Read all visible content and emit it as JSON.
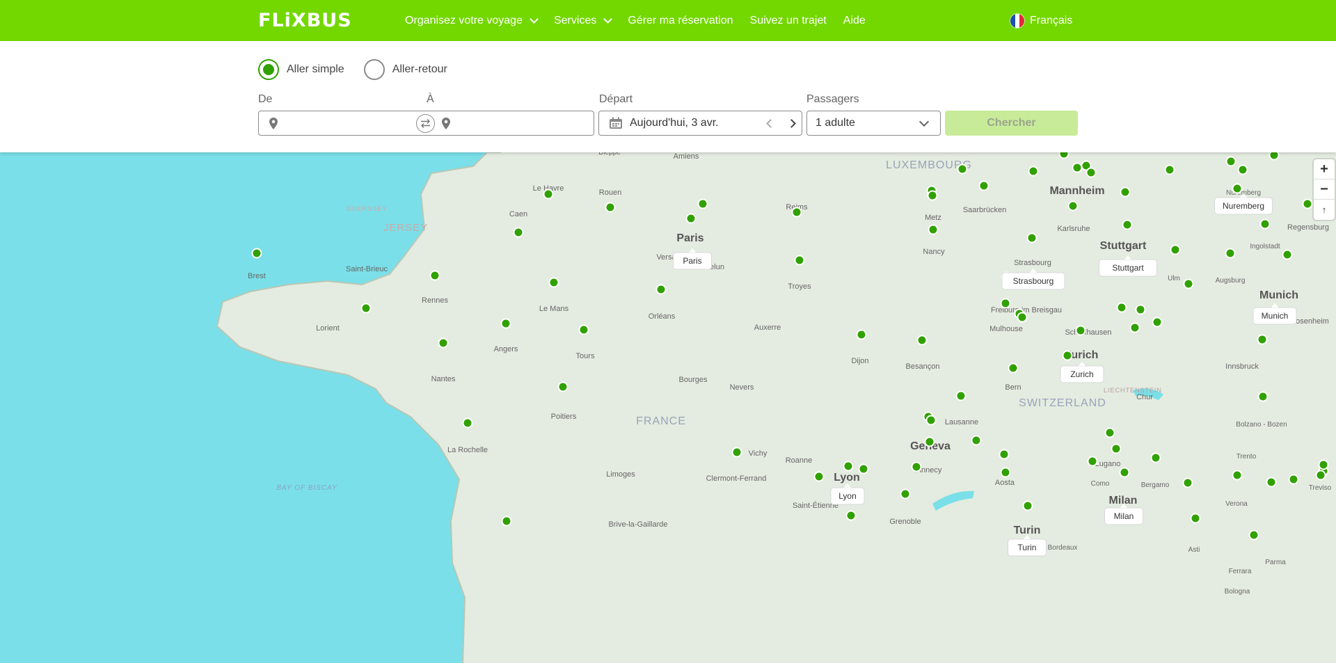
{
  "header": {
    "logo": "FLiXBUS",
    "nav": [
      {
        "label": "Organisez votre voyage",
        "has_dropdown": true
      },
      {
        "label": "Services",
        "has_dropdown": true
      },
      {
        "label": "Gérer ma réservation",
        "has_dropdown": false
      },
      {
        "label": "Suivez un trajet",
        "has_dropdown": false
      },
      {
        "label": "Aide",
        "has_dropdown": false
      }
    ],
    "language": "Français",
    "brand_color": "#73d700"
  },
  "search": {
    "trip_type": {
      "one_way": "Aller simple",
      "round_trip": "Aller-retour",
      "selected": "one_way"
    },
    "from_label": "De",
    "to_label": "À",
    "from_value": "",
    "to_value": "",
    "departure_label": "Départ",
    "departure_value": "Aujourd'hui, 3 avr.",
    "passengers_label": "Passagers",
    "passengers_value": "1 adulte",
    "search_button": "Chercher"
  },
  "map": {
    "zoom_in": "+",
    "zoom_out": "−",
    "compass": "↑",
    "regions": [
      {
        "label": "LUXEMBOURG"
      },
      {
        "label": "SWITZERLAND"
      },
      {
        "label": "FRANCE"
      },
      {
        "label": "JERSEY"
      },
      {
        "label": "GUERNSEY"
      },
      {
        "label": "BAY OF BISCAY"
      },
      {
        "label": "LIECHTENSTEIN"
      }
    ],
    "city_names": [
      "Dieppe",
      "Amiens",
      "Le Havre",
      "Rouen",
      "Caen",
      "Reims",
      "Paris",
      "Versailles",
      "Melun",
      "Metz",
      "Saarbrücken",
      "Mannheim",
      "Karlsruhe",
      "Nuremberg",
      "Regensburg",
      "Nancy",
      "Stuttgart",
      "Strasbourg",
      "Ingolstadt",
      "Brest",
      "Saint-Brieuc",
      "Rennes",
      "Le Mans",
      "Troyes",
      "Ulm",
      "Augsburg",
      "Munich",
      "Rosenheim",
      "Lorient",
      "Orléans",
      "Auxerre",
      "Freiburg im Breisgau",
      "Mulhouse",
      "Schaffhausen",
      "Angers",
      "Tours",
      "Zurich",
      "Dijon",
      "Besançon",
      "Nantes",
      "Bourges",
      "Nevers",
      "Innsbruck",
      "Bern",
      "Chur",
      "Poitiers",
      "Lausanne",
      "Bolzano - Bozen",
      "La Rochelle",
      "Geneva",
      "Vichy",
      "Roanne",
      "Trento",
      "Lugano",
      "Annecy",
      "Limoges",
      "Clermont-Ferrand",
      "Lyon",
      "Como",
      "Aosta",
      "Bergamo",
      "Milan",
      "Verona",
      "Treviso",
      "Saint-Étienne",
      "Grenoble",
      "Brive-la-Gaillarde",
      "Turin",
      "Bordeaux",
      "Asti",
      "Parma",
      "Ferrara",
      "Bologna"
    ],
    "popup_labels": [
      "Paris",
      "Nuremberg",
      "Stuttgart",
      "Strasbourg",
      "Munich",
      "Zurich",
      "Lyon",
      "Milan",
      "Turin"
    ],
    "colors": {
      "water": "#7adfe8",
      "land": "#e4ebe0",
      "stop": "#31a100"
    }
  }
}
